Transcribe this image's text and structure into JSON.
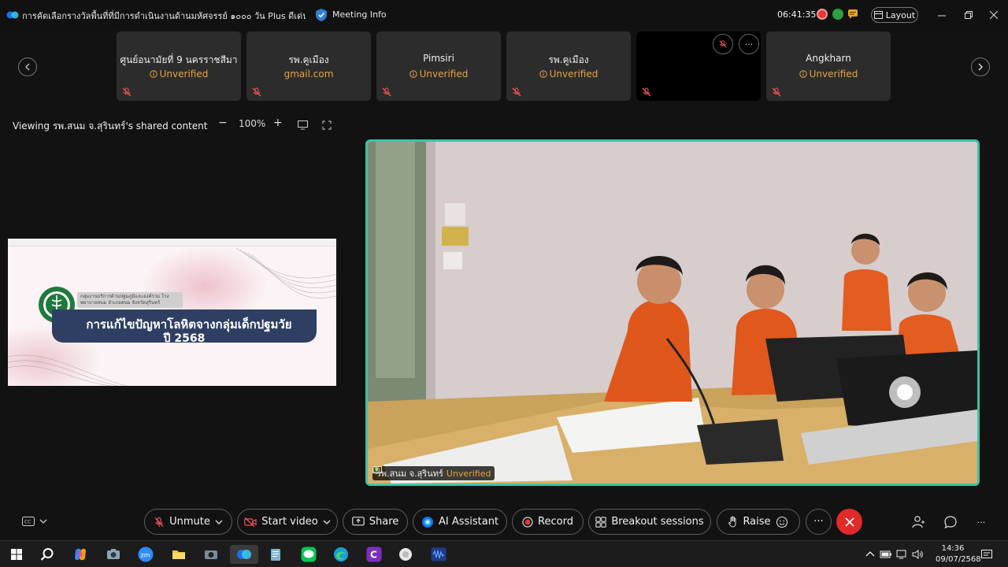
{
  "window": {
    "title": "การคัดเลือกรางวัลพื้นที่ที่มีการดำเนินงานด้านมหัศจรรย์ ๑๐๐๐ วัน Plus ดีเด่น ระดับเ...",
    "meeting_info_label": "Meeting Info",
    "clock": "06:41:35",
    "layout_label": "Layout"
  },
  "participants": [
    {
      "name": "ศูนย์อนามัยที่ 9 นครราชสีมา",
      "status": "Unverified",
      "muted": true
    },
    {
      "name": "รพ.คูเมือง",
      "status": "gmail.com",
      "muted": true
    },
    {
      "name": "Pimsiri",
      "status": "Unverified",
      "muted": true
    },
    {
      "name": "รพ.คูเมือง",
      "status": "Unverified",
      "muted": true
    },
    {
      "name": "",
      "status": "",
      "muted": true
    },
    {
      "name": "Angkharn",
      "status": "Unverified",
      "muted": true
    }
  ],
  "viewing": {
    "label": "Viewing รพ.สนม จ.สุรินทร์'s shared content",
    "zoom": "100%",
    "minus": "−",
    "plus": "+"
  },
  "slide": {
    "org_text": "กลุ่มงานบริการด้านปฐมภูมิและองค์รวม โรงพยาบาลสนม อำเภอสนม จังหวัดสุรินทร์",
    "title_line1": "การแก้ไขปัญหาโลหิตจางกลุ่มเด็กปฐมวัย",
    "title_line2": "ปี 2568"
  },
  "video": {
    "speaker": "รพ.สนม จ.สุรินทร์",
    "status": "Unverified"
  },
  "controls": {
    "unmute": "Unmute",
    "start_video": "Start video",
    "share": "Share",
    "ai_assistant": "AI Assistant",
    "record": "Record",
    "breakout": "Breakout sessions",
    "raise": "Raise",
    "more": "···"
  },
  "taskbar": {
    "time": "14:36",
    "date": "09/07/2568"
  },
  "colors": {
    "accent_teal": "#3fc2a8",
    "warning": "#e8a33d",
    "end_red": "#e02a2a",
    "record_red": "#e53935",
    "slide_banner": "#2f3f63"
  }
}
